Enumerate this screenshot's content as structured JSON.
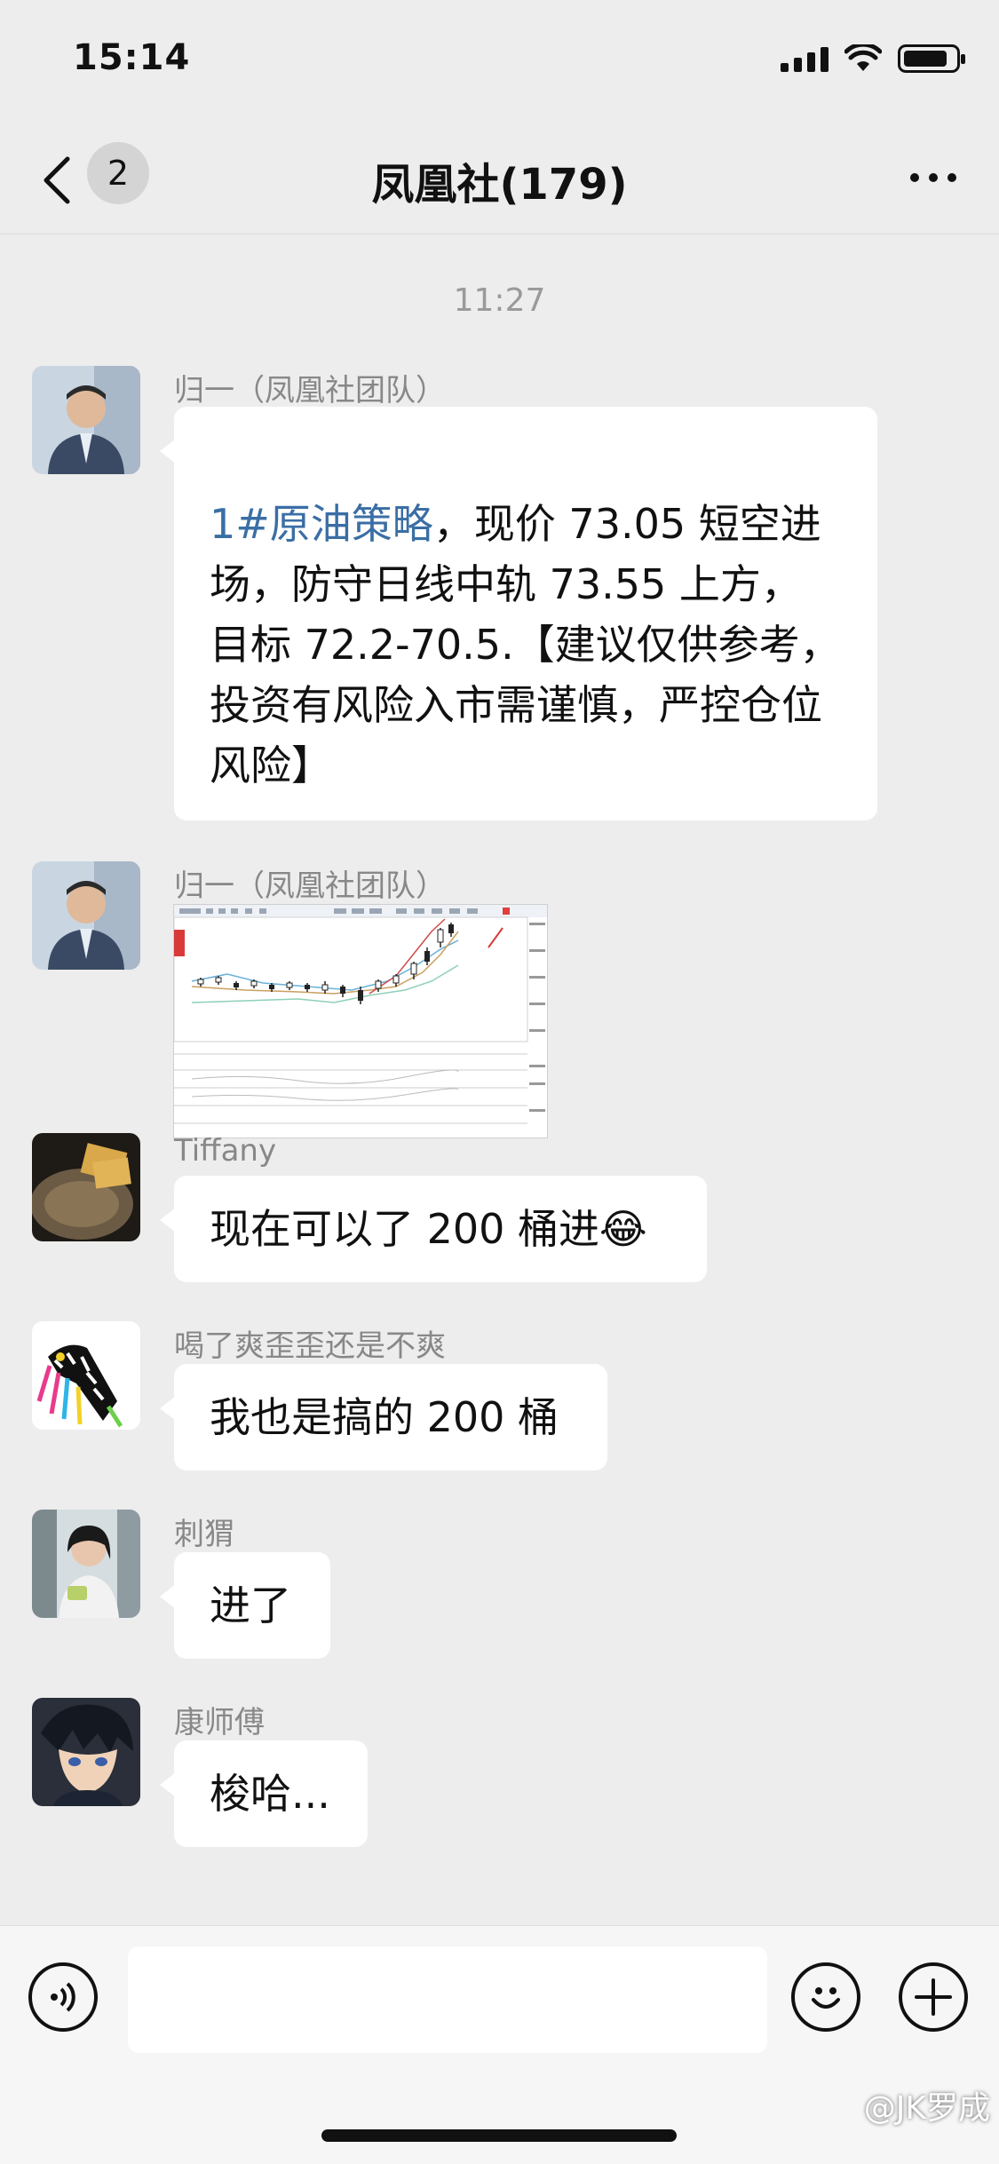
{
  "status_bar": {
    "time": "15:14"
  },
  "nav": {
    "back_count": "2",
    "title": "凤凰社(179)"
  },
  "chat": {
    "time_divider": "11:27",
    "messages": [
      {
        "sender": "归一（凤凰社团队）",
        "hashtag": "1#原油策略",
        "text": "，现价 73.05 短空进场，防守日线中轨 73.55 上方，目标 72.2-70.5.【建议仅供参考，投资有风险入市需谨慎，严控仓位风险】"
      },
      {
        "sender": "归一（凤凰社团队）",
        "type": "image"
      },
      {
        "sender": "Tiffany",
        "text": "现在可以了 200 桶进😂"
      },
      {
        "sender": "喝了爽歪歪还是不爽",
        "text": "我也是搞的 200 桶"
      },
      {
        "sender": "刺猬",
        "text": "进了"
      },
      {
        "sender": "康师傅",
        "text": "梭哈..."
      }
    ]
  },
  "input": {
    "placeholder": ""
  },
  "watermark": "@JK罗成",
  "colors": {
    "background": "#ededed",
    "bubble": "#ffffff",
    "hashtag": "#3a6ea5"
  }
}
